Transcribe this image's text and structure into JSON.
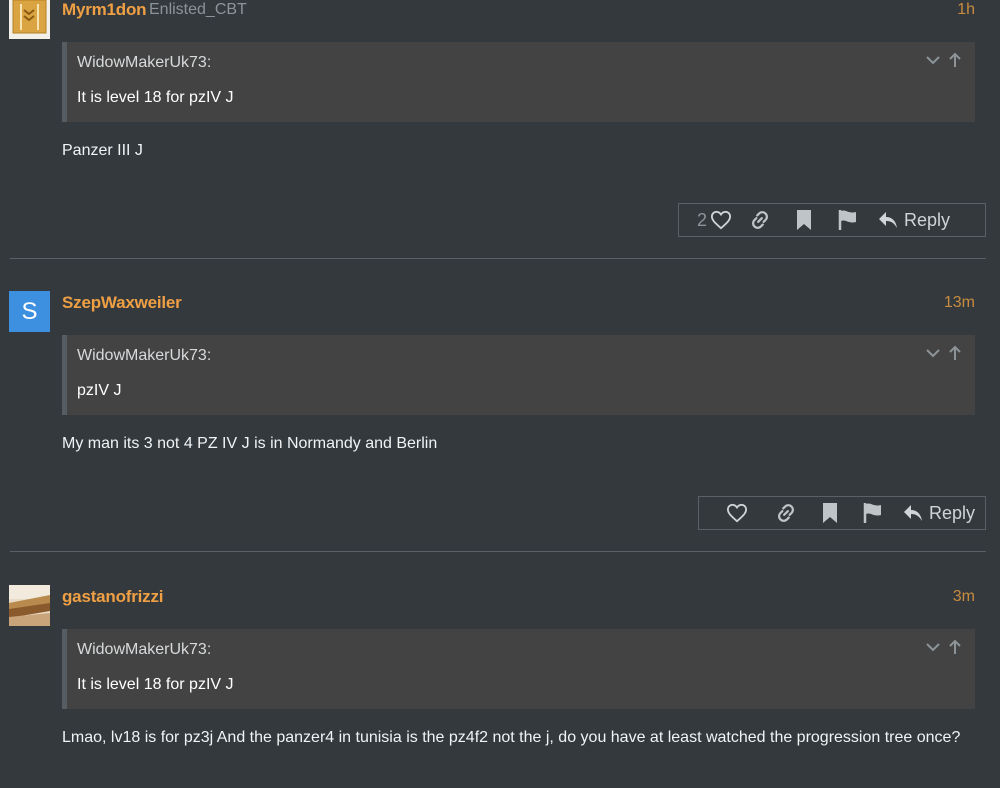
{
  "posts": [
    {
      "username": "Myrm1don",
      "user_title": "Enlisted_CBT",
      "time": "1h",
      "avatar_icon": "shield-emblem-icon",
      "quote": {
        "author": "WidowMakerUk73:",
        "text": "It is level 18 for pzIV J"
      },
      "body": "Panzer III J",
      "like_count": "2",
      "reply_label": "Reply"
    },
    {
      "username": "SzepWaxweiler",
      "time": "13m",
      "avatar_letter": "S",
      "avatar_color": "#3d8fe0",
      "quote": {
        "author": "WidowMakerUk73:",
        "text": "pzIV J"
      },
      "body": "My man its 3 not 4 PZ IV J is in Normandy and Berlin",
      "reply_label": "Reply"
    },
    {
      "username": "gastanofrizzi",
      "time": "3m",
      "avatar_icon": "photo-avatar-icon",
      "quote": {
        "author": "WidowMakerUk73:",
        "text": "It is level 18 for pzIV J"
      },
      "body": "Lmao, lv18 is for pz3j And the panzer4 in tunisia is the pz4f2 not the j, do you have at least watched the progression tree once?"
    }
  ],
  "colors": {
    "background": "#33393d",
    "username": "#f0a044",
    "quote_bg": "#434343",
    "time": "#c98b3f"
  }
}
